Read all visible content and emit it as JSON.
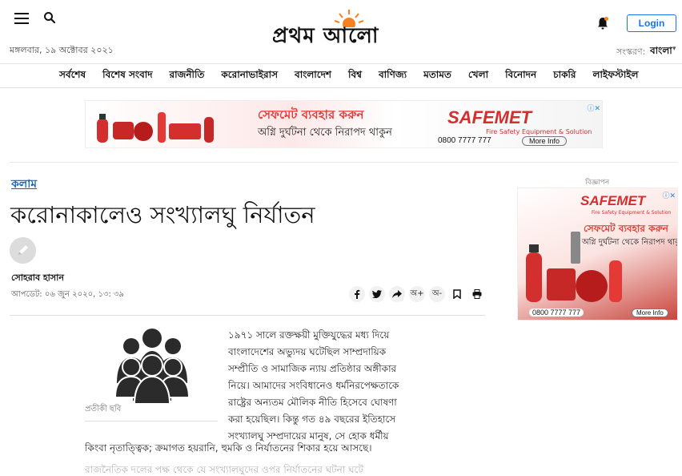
{
  "header": {
    "logo_text": "প্রথম আলো",
    "date": "মঙ্গলবার, ১৯ অক্টোবর ২০২১",
    "login_label": "Login",
    "edition_label": "সংস্করণ:",
    "edition_value": "বাংলা"
  },
  "nav": {
    "items": [
      "সর্বশেষ",
      "বিশেষ সংবাদ",
      "রাজনীতি",
      "করোনাভাইরাস",
      "বাংলাদেশ",
      "বিশ্ব",
      "বাণিজ্য",
      "মতামত",
      "খেলা",
      "বিনোদন",
      "চাকরি",
      "লাইফস্টাইল"
    ]
  },
  "banner_ad": {
    "headline": "সেফমেট ব্যবহার করুন",
    "subline": "অগ্নি দুর্ঘটনা থেকে নিরাপদ থাকুন",
    "brand": "SAFEMET",
    "tagline": "Fire Safety Equipment & Solution",
    "phone": "0800 7777 777",
    "more": "More Info"
  },
  "article": {
    "category": "কলাম",
    "headline": "করোনাকালেও সংখ্যালঘু নির্যাতন",
    "author": "সোহরাব হাসান",
    "updated": "আপডেট: ০৬ জুন ২০২০, ১৩: ৩৯",
    "caption": "প্রতীকী ছবি",
    "body_lines": [
      "১৯৭১ সালে রক্তক্ষয়ী মুক্তিযুদ্ধের মধ্য দিয়ে",
      "বাংলাদেশের অভ্যুদয় ঘটেছিল সাম্প্রদায়িক",
      "সম্প্রীতি ও সামাজিক ন্যায় প্রতিষ্ঠার অঙ্গীকার",
      "নিয়ে। আমাদের সংবিধানেও ধর্মনিরপেক্ষতাকে",
      "রাষ্ট্রের অন্যতম মৌলিক নীতি হিসেবে ঘোষণা",
      "করা হয়েছিল। কিন্তু গত ৪৯ বছরের ইতিহাসে",
      "সংখ্যালঘু সম্প্রদায়ের মানুষ, সে হোক ধর্মীয়"
    ],
    "body_line_full": "কিংবা নৃতাত্ত্বিক; ক্রমাগত হয়রানি, হুমকি ও নির্যাতনের শিকার হয়ে আসছে।",
    "body_faded": "রাজনৈতিক দলের পক্ষ থেকে যে সংখ্যালঘুদের ওপর নির্যাতনের ঘটনা ঘটে"
  },
  "share": {
    "font_up": "অ+",
    "font_down": "অ-"
  },
  "side_ad": {
    "label": "বিজ্ঞাপন",
    "brand": "SAFEMET",
    "tagline": "Fire Safety Equipment & Solution",
    "headline": "সেফমেট ব্যবহার করুন",
    "subline": "অগ্নি দুর্ঘটনা থেকে নিরাপদ থাকুন",
    "phone": "0800 7777 777",
    "more": "More Info"
  },
  "colors": {
    "link_blue": "#1565c0",
    "login_blue": "#1a73e8",
    "ad_red": "#d32f2f",
    "logo_sun": "#f5821f"
  }
}
